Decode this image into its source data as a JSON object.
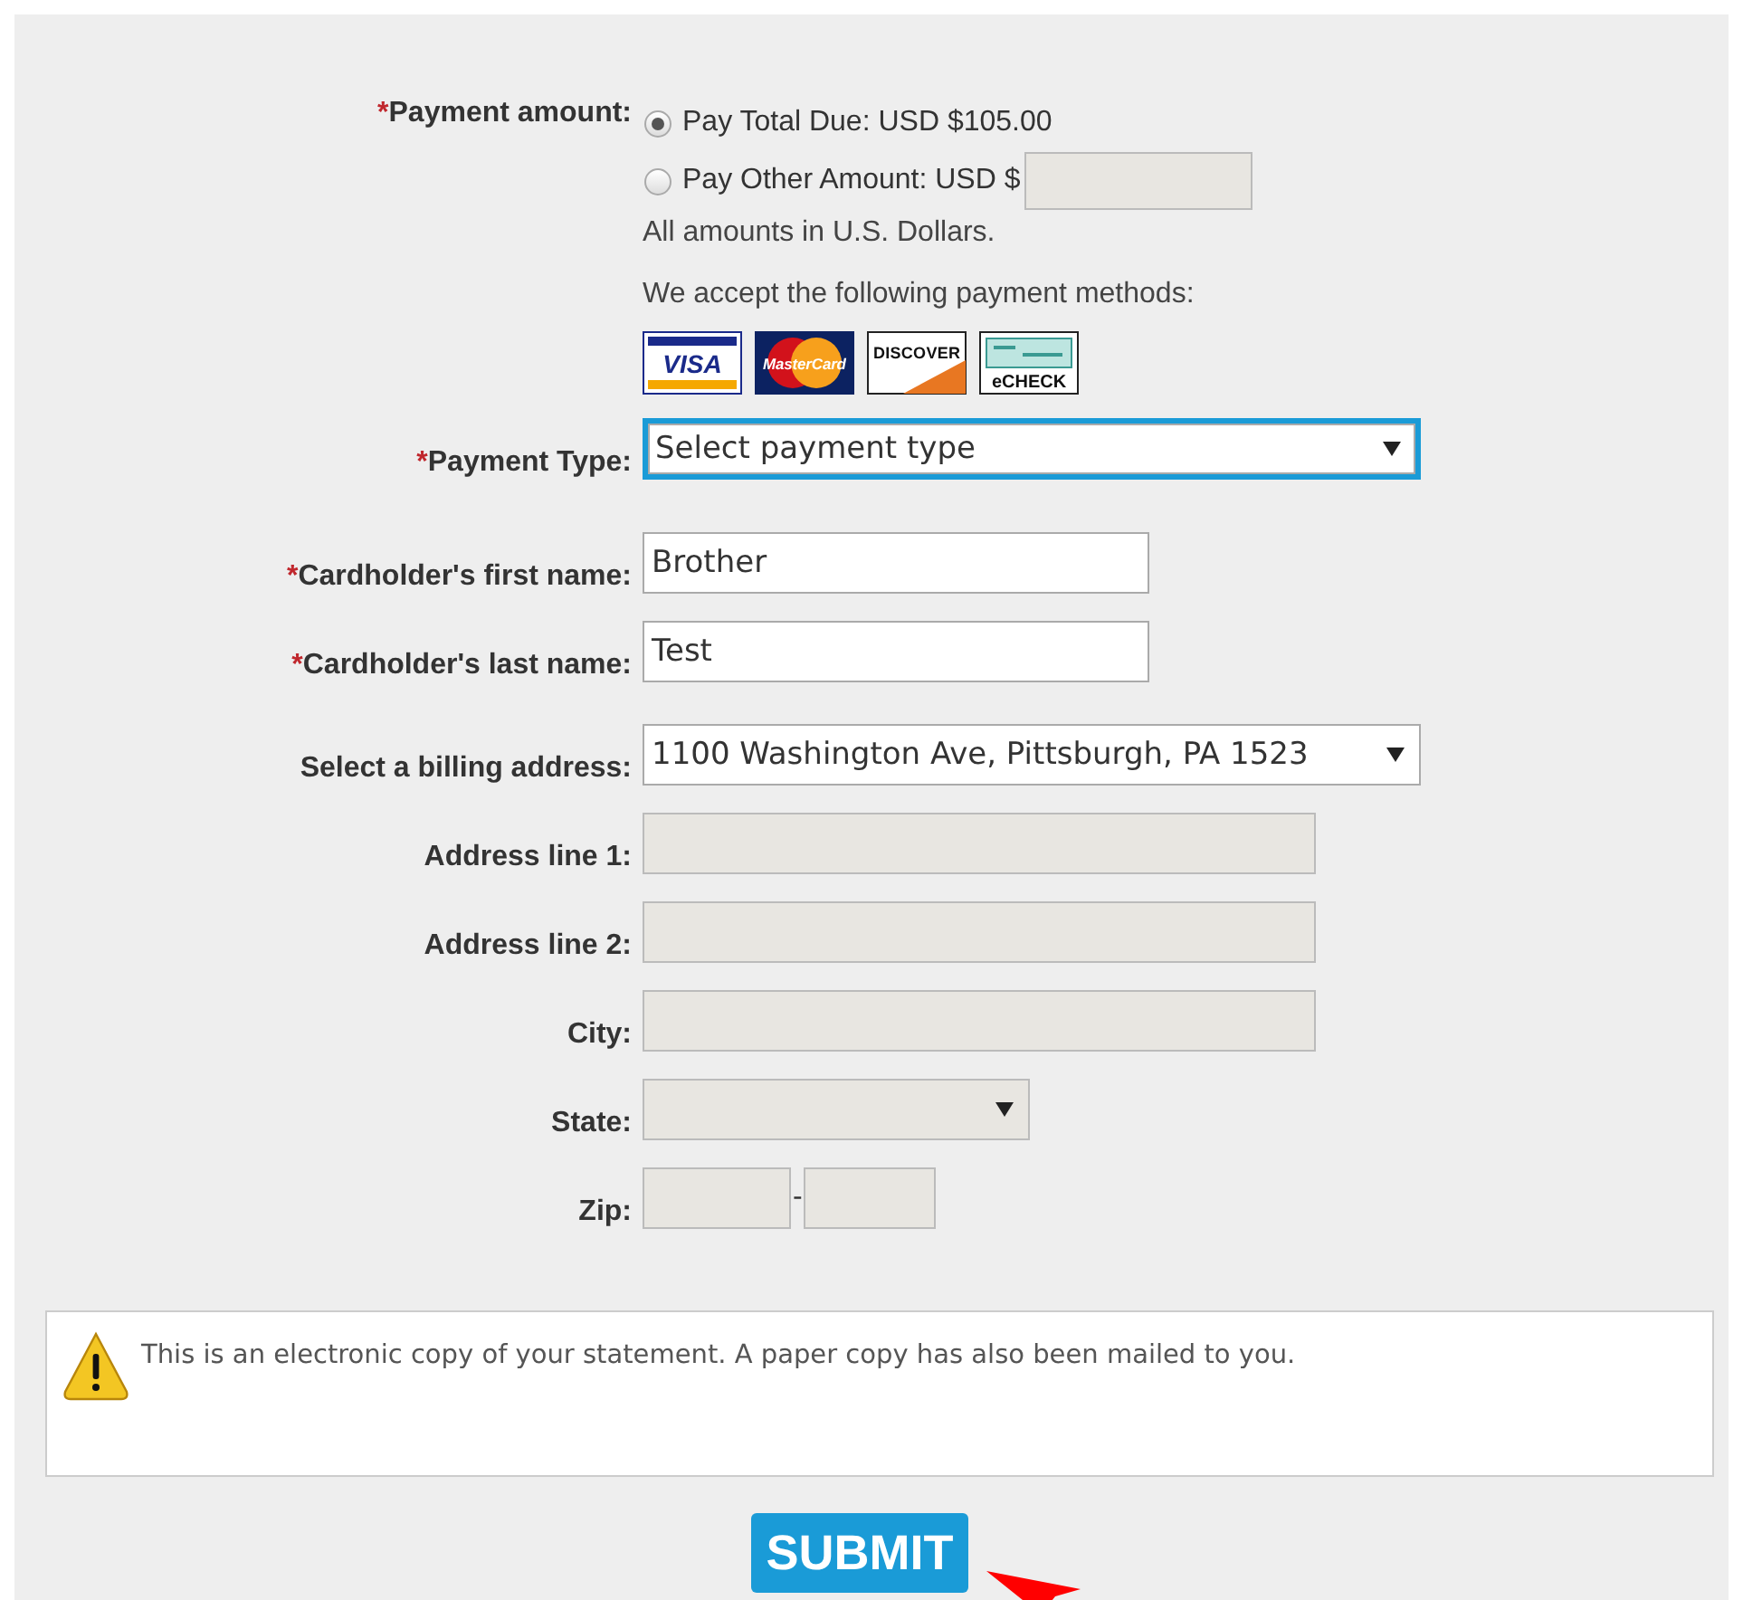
{
  "payment_amount": {
    "required_mark": "*",
    "label": "Payment amount:",
    "options": [
      {
        "label": "Pay Total Due: USD $105.00",
        "selected": true
      },
      {
        "label": "Pay Other Amount: USD $",
        "selected": false,
        "kind": "with-field"
      }
    ],
    "note": "All amounts in U.S. Dollars."
  },
  "payment_methods": {
    "text": "We accept the following payment methods:",
    "logos": [
      {
        "kind": "visa",
        "label": "VISA"
      },
      {
        "kind": "mastercard",
        "label": "MasterCard"
      },
      {
        "kind": "discover",
        "label": "DISCOVER"
      },
      {
        "kind": "echeck",
        "label": "eCHECK"
      }
    ]
  },
  "sections": [
    [
      {
        "kind": "select",
        "required_mark": "*",
        "label": "Payment Type:",
        "value": "Select payment type",
        "focused": true
      }
    ],
    [
      {
        "kind": "text",
        "required_mark": "*",
        "label": "Cardholder's first name:",
        "value": "Brother"
      },
      {
        "kind": "text",
        "required_mark": "*",
        "label": "Cardholder's last name:",
        "value": "Test"
      }
    ],
    [
      {
        "kind": "select",
        "label": "Select a billing address:",
        "value": "1100 Washington Ave, Pittsburgh, PA 1523"
      },
      {
        "kind": "text",
        "label": "Address line 1:",
        "disabled": true
      },
      {
        "kind": "text",
        "label": "Address line 2:",
        "disabled": true
      },
      {
        "kind": "text",
        "label": "City:",
        "disabled": true
      },
      {
        "kind": "select",
        "label": "State:",
        "disabled": true
      },
      {
        "kind": "zip",
        "label": "Zip:",
        "disabled": true,
        "separator": "-"
      }
    ]
  ],
  "notice": {
    "kind": "warning",
    "text": "This is an electronic copy of your statement. A paper copy has also been mailed to you."
  },
  "submit": {
    "label": "SUBMIT"
  }
}
